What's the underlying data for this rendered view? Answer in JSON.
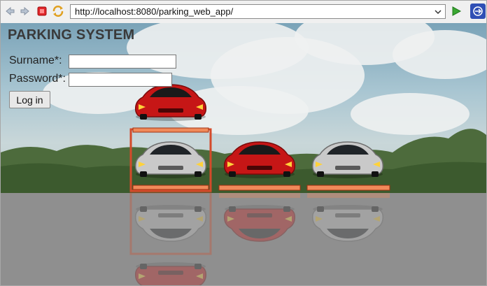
{
  "browser": {
    "url": "http://localhost:8080/parking_web_app/",
    "buttons": [
      "back-icon",
      "forward-icon",
      "stop-icon",
      "refresh-icon",
      "go-icon",
      "extension-icon"
    ]
  },
  "page": {
    "title": "PARKING SYSTEM",
    "surname_label": "Surname*:",
    "password_label": "Password*:",
    "surname_value": "",
    "password_value": "",
    "login_label": "Log in"
  },
  "scene": {
    "cars": [
      {
        "color": "#c61616",
        "spot": "top-lift"
      },
      {
        "color": "#c8c8c8",
        "spot": "lift-bottom"
      },
      {
        "color": "#c61616",
        "spot": "middle"
      },
      {
        "color": "#c8c8c8",
        "spot": "right"
      }
    ]
  }
}
